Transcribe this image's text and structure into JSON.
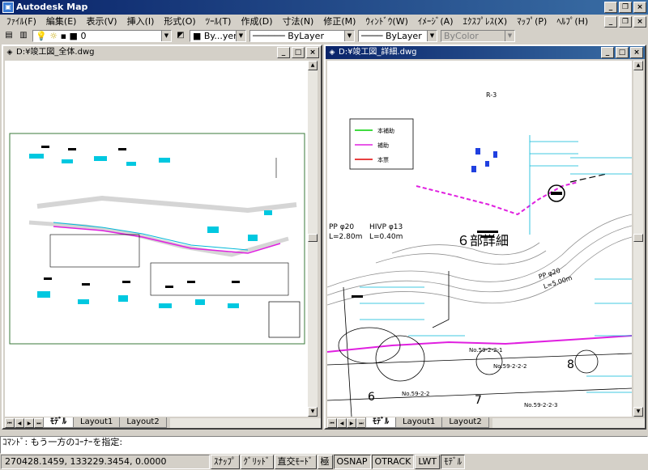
{
  "app": {
    "title": "Autodesk Map"
  },
  "menu": [
    "ﾌｧｲﾙ(F)",
    "編集(E)",
    "表示(V)",
    "挿入(I)",
    "形式(O)",
    "ﾂｰﾙ(T)",
    "作成(D)",
    "寸法(N)",
    "修正(M)",
    "ｳｨﾝﾄﾞｳ(W)",
    "ｲﾒｰｼﾞ(A)",
    "ｴｸｽﾌﾟﾚｽ(X)",
    "ﾏｯﾌﾟ(P)",
    "ﾍﾙﾌﾟ(H)"
  ],
  "toolbar": {
    "layer_value": "0",
    "color_value": "By...yer",
    "linetype_value": "ByLayer",
    "lineweight_value": "ByLayer",
    "plotstyle_value": "ByColor"
  },
  "left_window": {
    "title": "D:¥竣工図_全体.dwg",
    "tabs": [
      "ﾓﾃﾞﾙ",
      "Layout1",
      "Layout2"
    ]
  },
  "right_window": {
    "title": "D:¥竣工図_詳細.dwg",
    "tabs": [
      "ﾓﾃﾞﾙ",
      "Layout1",
      "Layout2"
    ],
    "drawing": {
      "legend": [
        "本補助",
        "補助",
        "本票"
      ],
      "detail_title": "６部詳細",
      "label_r3": "R-3",
      "label_pp20": "PP φ20",
      "label_l280": "L=2.80m",
      "label_hivp": "HIVP φ13",
      "label_l040": "L=0.40m",
      "label_pp20b": "PP φ20",
      "label_l500": "L=5.00m",
      "label_no1": "No.59-2-2-1",
      "label_no2": "No.59-2-2-2",
      "label_no3": "No.59-2-2",
      "label_no4": "No.59-2-2-3",
      "num6": "6",
      "num7": "7",
      "num8": "8"
    }
  },
  "command": {
    "text": "ｺﾏﾝﾄﾞ: もう一方のｺｰﾅｰを指定:"
  },
  "status": {
    "coords": "270428.1459, 133229.3454, 0.0000",
    "buttons": [
      "ｽﾅｯﾌﾟ",
      "ｸﾞﾘｯﾄﾞ",
      "直交ﾓｰﾄﾞ",
      "極",
      "OSNAP",
      "OTRACK",
      "LWT",
      "ﾓﾃﾞﾙ"
    ]
  },
  "colors": {
    "accent": "#0a246a",
    "cyan": "#00b8d8",
    "magenta": "#e020e0",
    "canvas": "#ffffff"
  }
}
